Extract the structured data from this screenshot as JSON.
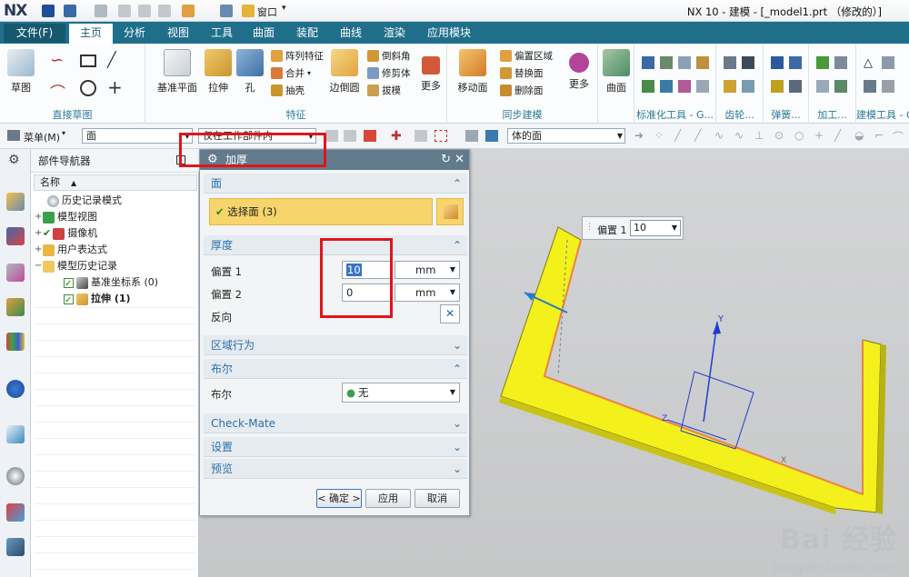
{
  "titlebar": {
    "logo": "NX",
    "title": "NX 10 - 建模 - [_model1.prt （修改的）]",
    "window_menu": "窗口"
  },
  "ribbon_tabs": [
    {
      "label": "文件(F)"
    },
    {
      "label": "主页"
    },
    {
      "label": "分析"
    },
    {
      "label": "视图"
    },
    {
      "label": "工具"
    },
    {
      "label": "曲面"
    },
    {
      "label": "装配"
    },
    {
      "label": "曲线"
    },
    {
      "label": "渲染"
    },
    {
      "label": "应用模块"
    }
  ],
  "ribbon": {
    "sketch_label": "草图",
    "group_direct_sketch": "直接草图",
    "datum_plane": "基准平面",
    "extrude": "拉伸",
    "hole": "孔",
    "pattern_feature": "阵列特征",
    "unite": "合并",
    "shell": "抽壳",
    "edge_blend": "边倒圆",
    "chamfer": "倒斜角",
    "trim_body": "修剪体",
    "draft": "拔模",
    "more1": "更多",
    "group_feature": "特征",
    "move_face": "移动面",
    "offset_region": "偏置区域",
    "replace_face": "替换面",
    "delete_face": "删除面",
    "more2": "更多",
    "group_sync": "同步建模",
    "surface": "曲面",
    "group_std": "标准化工具 - G...",
    "group_gear": "齿轮...",
    "group_spring": "弹簧...",
    "group_machining": "加工...",
    "group_modeling_tools": "建模工具 - G..."
  },
  "cmdbar": {
    "menu": "菜单(M)",
    "filter": "面",
    "scope": "仅在工作部件内",
    "face_rule": "体的面"
  },
  "navigator": {
    "title": "部件导航器",
    "column_name": "名称",
    "items": [
      {
        "label": "历史记录模式"
      },
      {
        "label": "模型视图"
      },
      {
        "label": "摄像机"
      },
      {
        "label": "用户表达式"
      },
      {
        "label": "模型历史记录"
      },
      {
        "label": "基准坐标系 (0)"
      },
      {
        "label": "拉伸 (1)"
      }
    ]
  },
  "dialog": {
    "title": "加厚",
    "sec_face": "面",
    "select_face": "选择面 (3)",
    "sec_thickness": "厚度",
    "offset1_label": "偏置 1",
    "offset1_value": "10",
    "offset2_label": "偏置 2",
    "offset2_value": "0",
    "unit": "mm",
    "reverse_label": "反向",
    "sec_region": "区域行为",
    "sec_boolean": "布尔",
    "boolean_label": "布尔",
    "boolean_value": "无",
    "sec_checkmate": "Check-Mate",
    "sec_settings": "设置",
    "sec_preview": "预览",
    "ok": "< 确定 >",
    "apply": "应用",
    "cancel": "取消"
  },
  "viewport": {
    "float_label": "偏置 1",
    "float_value": "10",
    "axis_y": "Y",
    "axis_z": "Z",
    "axis_x": "X"
  },
  "watermark": {
    "brand": "Bai 经验",
    "url": "jingyan.baidu.com"
  },
  "colors": {
    "ribbon_blue": "#1f6f8b",
    "part_yellow": "#f4f01c",
    "highlight_red": "#e1141c",
    "select_orange": "#f8d56c"
  }
}
